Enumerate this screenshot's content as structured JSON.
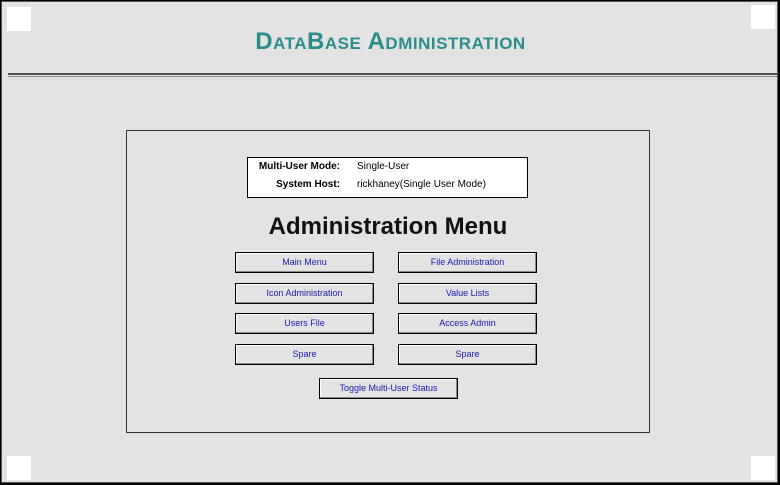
{
  "app": {
    "title": "DataBase  Administration"
  },
  "info": {
    "mode_label": "Multi-User Mode:",
    "mode_value": "Single-User",
    "host_label": "System Host:",
    "host_value": "rickhaney(Single User Mode)"
  },
  "menu": {
    "heading": "Administration Menu",
    "buttons": [
      "Main Menu",
      "File Administration",
      "Icon Administration",
      "Value Lists",
      "Users File",
      "Access Admin",
      "Spare",
      "Spare"
    ],
    "toggle_label": "Toggle Multi-User Status"
  },
  "colors": {
    "title": "#2b8c8c",
    "button_text": "#1a1ab0",
    "background": "#e3e3e3"
  }
}
